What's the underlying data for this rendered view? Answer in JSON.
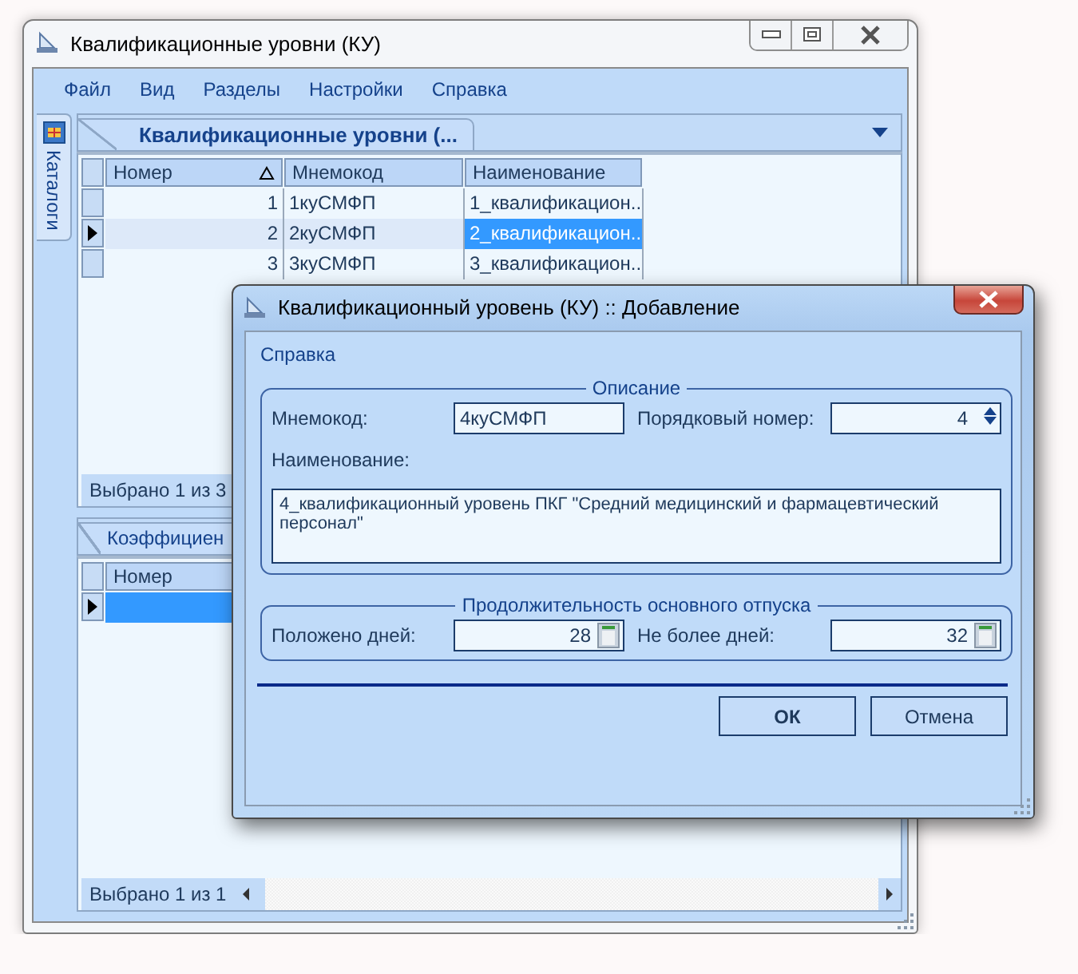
{
  "window": {
    "title": "Квалификационные уровни (КУ)"
  },
  "menu": [
    "Файл",
    "Вид",
    "Разделы",
    "Настройки",
    "Справка"
  ],
  "sidebar": {
    "tabs": [
      {
        "label": "Каталоги",
        "selected": true
      }
    ]
  },
  "top_panel": {
    "tab": {
      "label": "Квалификационные уровни (..."
    },
    "table": {
      "columns": [
        {
          "label": "Номер",
          "sorted": true
        },
        {
          "label": "Мнемокод",
          "sorted": false
        },
        {
          "label": "Наименование",
          "sorted": false
        }
      ],
      "rows": [
        {
          "cells": [
            "1",
            "1куСМФП",
            "1_квалификацион..."
          ],
          "selected": false
        },
        {
          "cells": [
            "2",
            "2куСМФП",
            "2_квалификацион..."
          ],
          "selected": true
        },
        {
          "cells": [
            "3",
            "3куСМФП",
            "3_квалификацион..."
          ],
          "selected": false
        }
      ]
    },
    "status": "Выбрано 1 из 3"
  },
  "bottom_panel": {
    "tab": {
      "label": "Коэффициен"
    },
    "table": {
      "columns": [
        {
          "label": "Номер",
          "sorted": false
        }
      ],
      "rows": [
        {
          "selected": true
        }
      ]
    },
    "status": "Выбрано 1 из 1"
  },
  "dialog": {
    "title": "Квалификационный уровень (КУ) :: Добавление",
    "menu": [
      "Справка"
    ],
    "description": {
      "title": "Описание",
      "mnemocode": {
        "label": "Мнемокод:",
        "value": "4куСМФП"
      },
      "order": {
        "label": "Порядковый номер:",
        "value": "4"
      },
      "name": {
        "label": "Наименование:",
        "value": "4_квалификационный уровень ПКГ \"Средний медицинский и фармацевтический персонал\""
      }
    },
    "vacation": {
      "title": "Продолжительность основного отпуска",
      "days": {
        "label": "Положено дней:",
        "value": "28"
      },
      "max_days": {
        "label": "Не более дней:",
        "value": "32"
      }
    },
    "buttons": [
      {
        "label": "ОК",
        "default": true
      },
      {
        "label": "Отмена",
        "default": false
      }
    ]
  }
}
